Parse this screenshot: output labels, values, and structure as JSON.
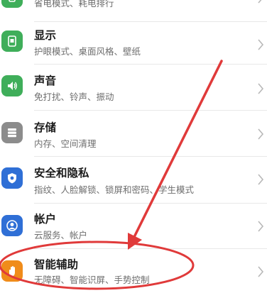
{
  "settings": {
    "items": [
      {
        "title": "",
        "subtitle": "省电模式、耗电排行",
        "icon": "battery-icon",
        "color": "#3fae5a"
      },
      {
        "title": "显示",
        "subtitle": "护眼模式、桌面风格、壁纸",
        "icon": "display-icon",
        "color": "#3fae5a"
      },
      {
        "title": "声音",
        "subtitle": "免打扰、铃声、振动",
        "icon": "speaker-icon",
        "color": "#3fae5a"
      },
      {
        "title": "存储",
        "subtitle": "内存、空间清理",
        "icon": "storage-icon",
        "color": "#8c8c8c"
      },
      {
        "title": "安全和隐私",
        "subtitle": "指纹、人脸解锁、锁屏和密码、学生模式",
        "icon": "shield-icon",
        "color": "#2f6fd6"
      },
      {
        "title": "帐户",
        "subtitle": "云服务、帐户",
        "icon": "account-icon",
        "color": "#2f6fd6"
      },
      {
        "title": "智能辅助",
        "subtitle": "无障碍、智能识屏、手势控制",
        "icon": "hand-icon",
        "color": "#f08c1a"
      }
    ]
  },
  "annotation": {
    "arrow_color": "#e03a3a",
    "circle_color": "#e03a3a"
  }
}
